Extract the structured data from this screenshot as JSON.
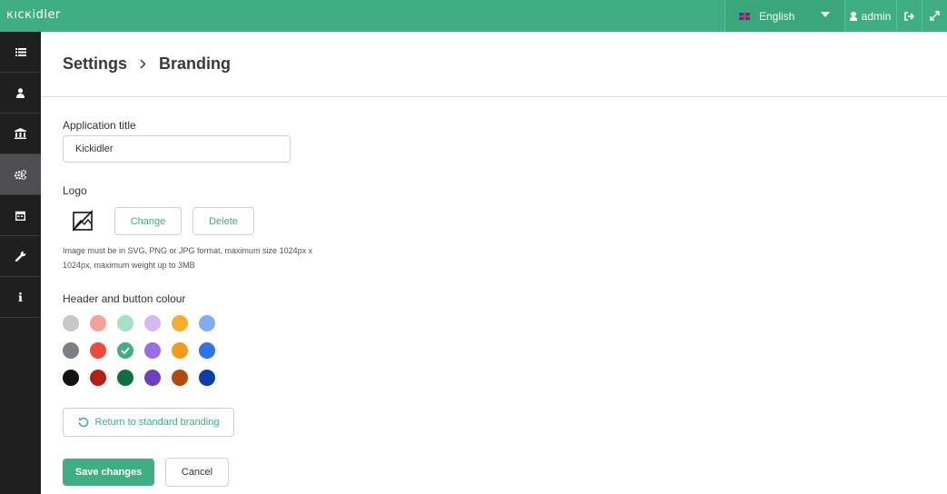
{
  "app": {
    "logo_text": "кıскidler"
  },
  "topbar": {
    "language": "English",
    "user": "admin",
    "icons": [
      "flag-uk-icon",
      "chevron-down-icon",
      "user-icon",
      "logout-icon",
      "fullscreen-icon"
    ]
  },
  "sidebar": {
    "items": [
      {
        "name": "dashboard",
        "icon": "list-icon",
        "active": false
      },
      {
        "name": "users",
        "icon": "user-icon",
        "active": false
      },
      {
        "name": "organization",
        "icon": "bank-icon",
        "active": false
      },
      {
        "name": "settings",
        "icon": "gears-icon",
        "active": true
      },
      {
        "name": "reports",
        "icon": "calendar-icon",
        "active": false
      },
      {
        "name": "tools",
        "icon": "wrench-icon",
        "active": false
      },
      {
        "name": "info",
        "icon": "info-icon",
        "active": false
      }
    ]
  },
  "breadcrumb": {
    "parent": "Settings",
    "separator": "›",
    "current": "Branding"
  },
  "form": {
    "app_title_label": "Application title",
    "app_title_value": "Kickidler",
    "logo_label": "Logo",
    "logo_change": "Change",
    "logo_delete": "Delete",
    "logo_hint": "Image must be in SVG, PNG or JPG format, maximum size 1024px x 1024px, maximum weight up to 3MB",
    "color_label": "Header and button colour",
    "colors": [
      [
        "#c8c8c8",
        "#f5a198",
        "#a4e2c6",
        "#d5b9f3",
        "#f6ad2e",
        "#82acef"
      ],
      [
        "#7c7f86",
        "#ec4a3e",
        "#3fae82",
        "#9b6ee6",
        "#f39a1b",
        "#2f74ea"
      ],
      [
        "#121212",
        "#b22118",
        "#0d6f3d",
        "#6f3fbf",
        "#b34a10",
        "#0b3ea8"
      ]
    ],
    "selected_color": "#3fae82",
    "reset_label": "Return to standard branding",
    "save_label": "Save changes",
    "cancel_label": "Cancel"
  },
  "colors": {
    "accent": "#3fae82",
    "sidebar": "#1f1f1f",
    "sidebar_active": "#4e4e52"
  }
}
